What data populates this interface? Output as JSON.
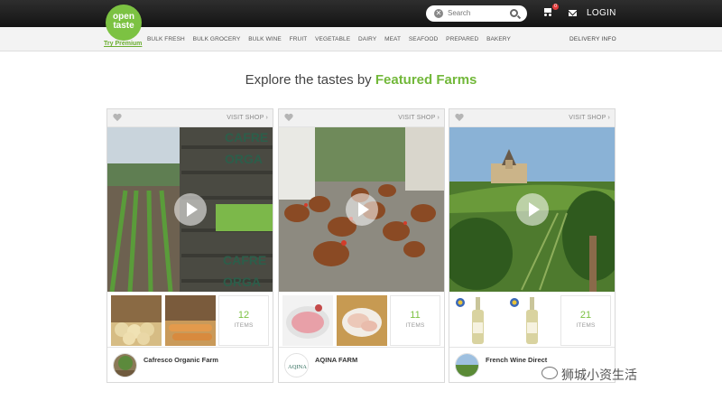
{
  "header": {
    "logo_line1": "open",
    "logo_line2": "taste",
    "try_premium": "Try Premium",
    "search_placeholder": "Search",
    "cart_count": "0",
    "login": "LOGIN"
  },
  "categories": [
    "BULK FRESH",
    "BULK GROCERY",
    "BULK WINE",
    "FRUIT",
    "VEGETABLE",
    "DAIRY",
    "MEAT",
    "SEAFOOD",
    "PREPARED",
    "BAKERY"
  ],
  "delivery_info": "DELIVERY INFO",
  "heading": {
    "prefix": "Explore the tastes by ",
    "highlight": "Featured Farms"
  },
  "farms": [
    {
      "visit": "VISIT SHOP ›",
      "items_count": "12",
      "items_label": "ITEMS",
      "name": "Cafresco Organic Farm",
      "hero_text1": "CAFRE",
      "hero_text2": "ORGA",
      "hero_text3": "CAFRE",
      "hero_text4": "ORGA"
    },
    {
      "visit": "VISIT SHOP ›",
      "items_count": "11",
      "items_label": "ITEMS",
      "name": "AQINA FARM",
      "avatar_text": "AQINA"
    },
    {
      "visit": "VISIT SHOP ›",
      "items_count": "21",
      "items_label": "ITEMS",
      "name": "French Wine Direct"
    }
  ],
  "watermark": "狮城小资生活",
  "colors": {
    "brand_green": "#7cc242",
    "topbar": "#1a1a1a",
    "badge": "#e23b3b"
  }
}
